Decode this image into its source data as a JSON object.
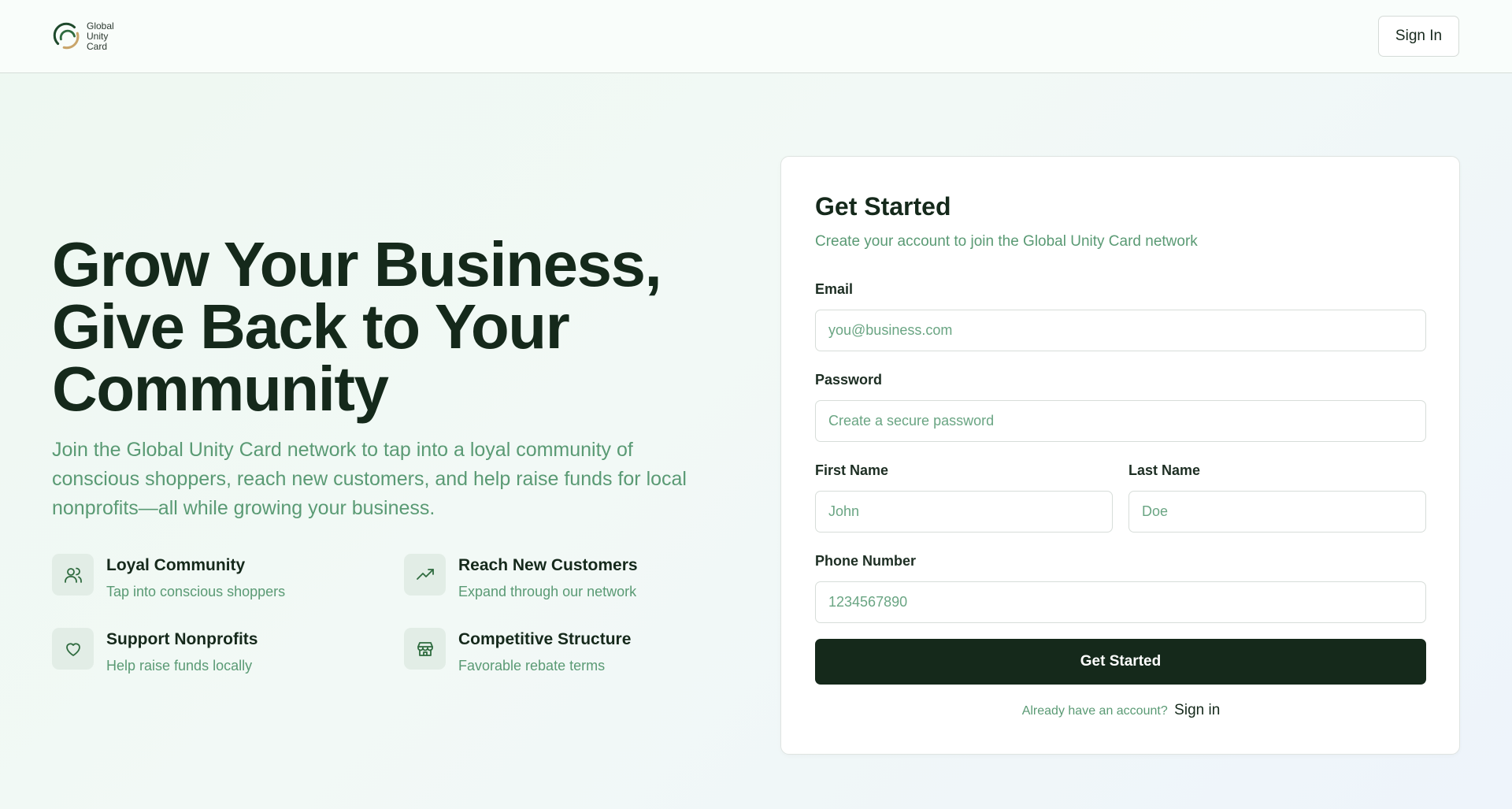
{
  "header": {
    "logo_lines": [
      "Global",
      "Unity",
      "Card"
    ],
    "sign_in_label": "Sign In"
  },
  "hero": {
    "title_lines": [
      "Grow Your Business,",
      "Give Back to Your",
      "Community"
    ],
    "subtitle": "Join the Global Unity Card network to tap into a loyal community of conscious shoppers, reach new customers, and help raise funds for local nonprofits—all while growing your business.",
    "features": [
      {
        "icon": "users-icon",
        "title": "Loyal Community",
        "desc": "Tap into conscious shoppers"
      },
      {
        "icon": "trending-up-icon",
        "title": "Reach New Customers",
        "desc": "Expand through our network"
      },
      {
        "icon": "heart-icon",
        "title": "Support Nonprofits",
        "desc": "Help raise funds locally"
      },
      {
        "icon": "store-icon",
        "title": "Competitive Structure",
        "desc": "Favorable rebate terms"
      }
    ]
  },
  "form": {
    "title": "Get Started",
    "subtitle": "Create your account to join the Global Unity Card network",
    "email": {
      "label": "Email",
      "placeholder": "you@business.com",
      "value": ""
    },
    "password": {
      "label": "Password",
      "placeholder": "Create a secure password",
      "value": ""
    },
    "first_name": {
      "label": "First Name",
      "placeholder": "John",
      "value": ""
    },
    "last_name": {
      "label": "Last Name",
      "placeholder": "Doe",
      "value": ""
    },
    "phone": {
      "label": "Phone Number",
      "placeholder": "1234567890",
      "value": ""
    },
    "submit_label": "Get Started",
    "footer_question": "Already have an account?",
    "footer_link": "Sign in"
  },
  "colors": {
    "primary_dark": "#15291b",
    "accent_green": "#5a9a74",
    "icon_bg": "#e2ede6",
    "logo_gold": "#c9a56a"
  }
}
